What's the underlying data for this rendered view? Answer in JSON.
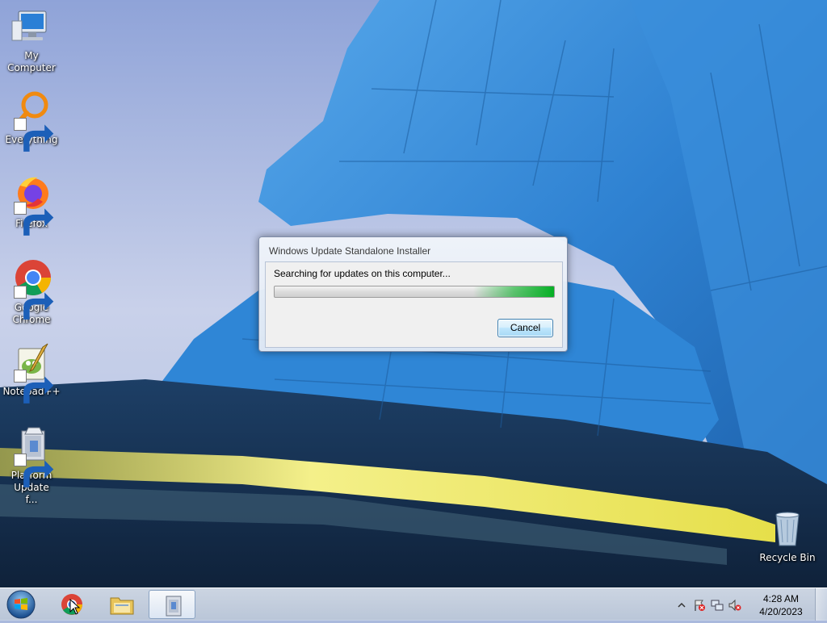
{
  "desktop": {
    "icons": [
      {
        "label": "My Computer",
        "icon": "computer-icon"
      },
      {
        "label": "Everything",
        "icon": "everything-icon",
        "shortcut": true
      },
      {
        "label": "Firefox",
        "icon": "firefox-icon",
        "shortcut": true
      },
      {
        "label": "Google Chrome",
        "icon": "chrome-icon",
        "shortcut": true
      },
      {
        "label": "Notepad++",
        "icon": "notepadpp-icon",
        "shortcut": true
      },
      {
        "label": "Platform Update f...",
        "icon": "installer-icon",
        "shortcut": true
      },
      {
        "label": "Recycle Bin",
        "icon": "recycle-bin-icon"
      }
    ]
  },
  "dialog": {
    "title": "Windows Update Standalone Installer",
    "message": "Searching for updates on this computer...",
    "progress_mode": "indeterminate",
    "cancel_label": "Cancel"
  },
  "taskbar": {
    "items": [
      {
        "name": "start-button",
        "icon": "windows-logo-icon"
      },
      {
        "name": "chrome",
        "icon": "chrome-icon"
      },
      {
        "name": "explorer",
        "icon": "folder-icon"
      },
      {
        "name": "wusa",
        "icon": "installer-icon",
        "active": true
      }
    ],
    "tray": {
      "icons": [
        "show-hidden-icons-chevron",
        "action-center-flag-icon",
        "network-icon",
        "volume-muted-icon"
      ],
      "time": "4:28 AM",
      "date": "4/20/2023"
    }
  },
  "colors": {
    "progress_green": "#06b025",
    "wallpaper_blue": "#2a7fd0",
    "taskbar": "#d6e0ee"
  }
}
